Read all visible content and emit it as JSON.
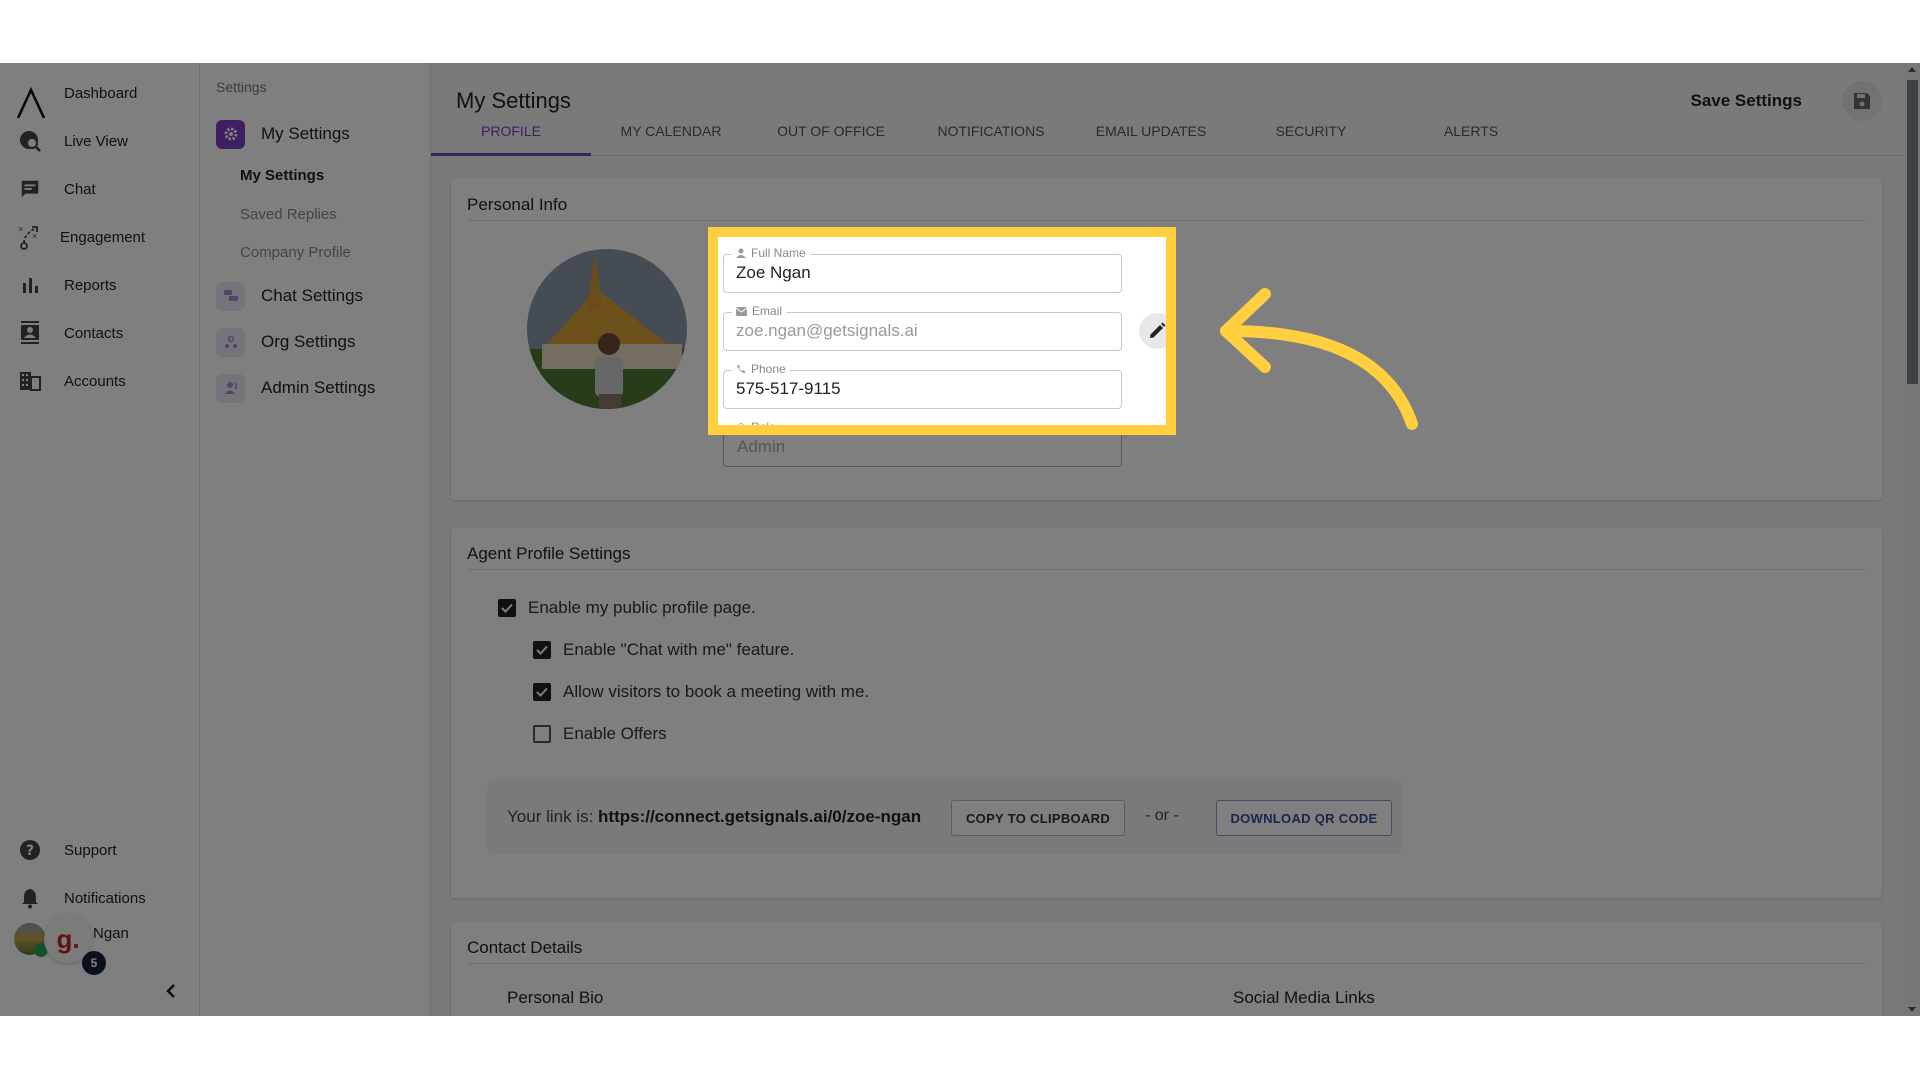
{
  "left_nav": {
    "items": [
      {
        "label": "Dashboard",
        "icon": "logo-icon"
      },
      {
        "label": "Live View",
        "icon": "live-view-icon"
      },
      {
        "label": "Chat",
        "icon": "chat-icon"
      },
      {
        "label": "Engagement",
        "icon": "engagement-icon"
      },
      {
        "label": "Reports",
        "icon": "bar-chart-icon"
      },
      {
        "label": "Contacts",
        "icon": "contact-card-icon"
      },
      {
        "label": "Accounts",
        "icon": "building-icon"
      }
    ],
    "bottom": {
      "support": "Support",
      "notifications": "Notifications",
      "user_name": "Ngan",
      "badge_count": "5",
      "brand_letter": "g."
    }
  },
  "settings_nav": {
    "header": "Settings",
    "groups": [
      {
        "label": "My Settings",
        "icon": "gear-icon",
        "active": true
      },
      {
        "label": "Chat Settings",
        "icon": "chat-bubbles-icon"
      },
      {
        "label": "Org Settings",
        "icon": "org-icon"
      },
      {
        "label": "Admin Settings",
        "icon": "admin-icon"
      }
    ],
    "sub_links": [
      {
        "label": "My Settings",
        "active": true
      },
      {
        "label": "Saved Replies"
      },
      {
        "label": "Company Profile"
      }
    ]
  },
  "main": {
    "title": "My Settings",
    "save_label": "Save Settings",
    "tabs": [
      {
        "label": "PROFILE",
        "active": true
      },
      {
        "label": "MY CALENDAR"
      },
      {
        "label": "OUT OF OFFICE"
      },
      {
        "label": "NOTIFICATIONS"
      },
      {
        "label": "EMAIL UPDATES"
      },
      {
        "label": "SECURITY"
      },
      {
        "label": "ALERTS"
      }
    ],
    "personal_info": {
      "title": "Personal Info",
      "full_name_label": "Full Name",
      "full_name_value": "Zoe Ngan",
      "email_label": "Email",
      "email_value": "zoe.ngan@getsignals.ai",
      "phone_label": "Phone",
      "phone_value": "575-517-9115",
      "role_label": "Role",
      "role_value": "Admin"
    },
    "agent_profile": {
      "title": "Agent Profile Settings",
      "options": [
        {
          "label": "Enable my public profile page.",
          "checked": true
        },
        {
          "label": "Enable \"Chat with me\" feature.",
          "checked": true
        },
        {
          "label": "Allow visitors to book a meeting with me.",
          "checked": true
        },
        {
          "label": "Enable Offers",
          "checked": false
        }
      ],
      "link_prefix": "Your link is: ",
      "link_url": "https://connect.getsignals.ai/0/zoe-ngan",
      "copy_button": "COPY TO CLIPBOARD",
      "or_text": "- or -",
      "qr_button": "DOWNLOAD QR CODE"
    },
    "contact_details": {
      "title": "Contact Details",
      "personal_bio": "Personal Bio",
      "social_links": "Social Media Links"
    }
  },
  "colors": {
    "accent": "#7b3fc4",
    "highlight": "#ffcf3f",
    "qr_button": "#3a4a9a"
  }
}
